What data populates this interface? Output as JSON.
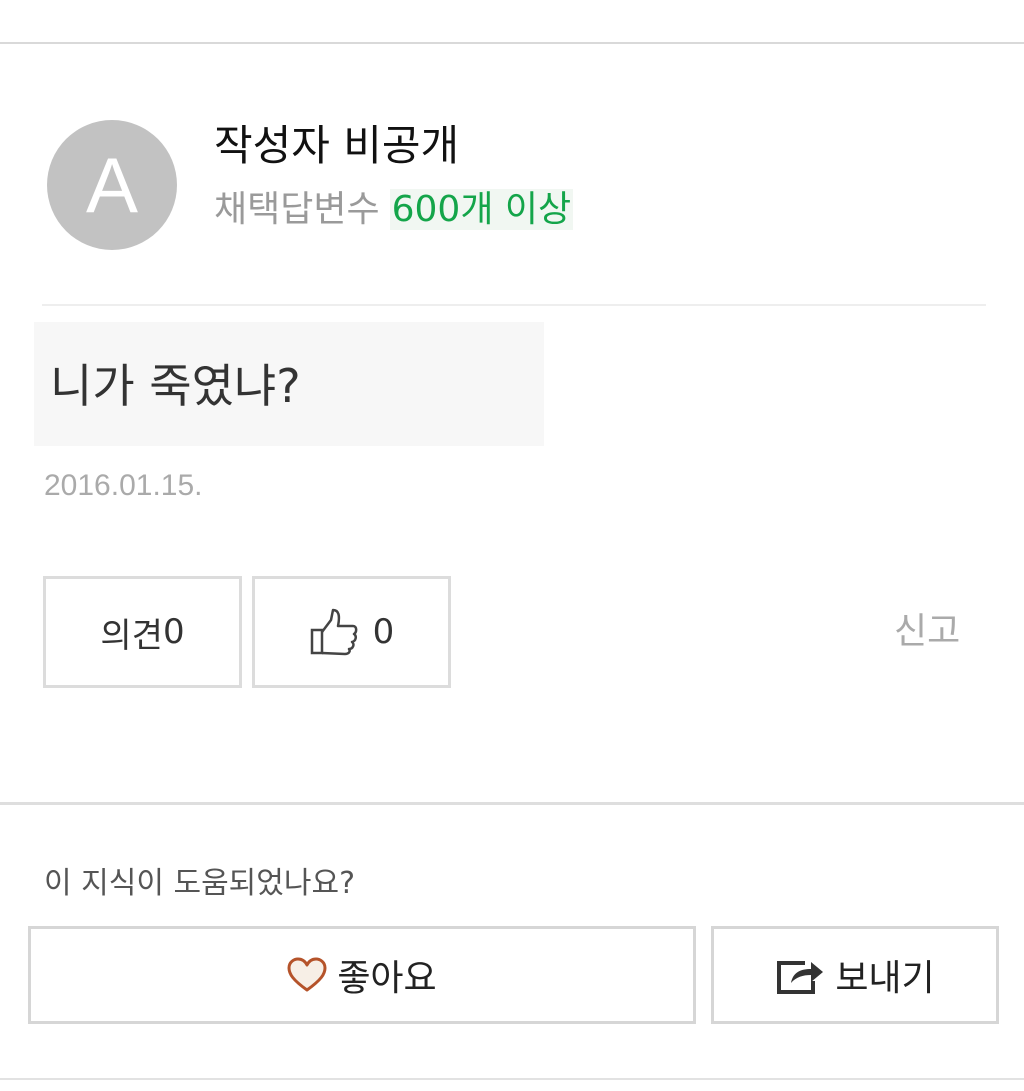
{
  "author": {
    "avatar_letter": "A",
    "name": "작성자 비공개",
    "meta_label": "채택답변수",
    "meta_count": "600개 이상",
    "count_color": "#14a54a"
  },
  "answer": {
    "text": "니가 죽였냐?",
    "date": "2016.01.15."
  },
  "actions": {
    "opinion_label": "의견",
    "opinion_count": "0",
    "like_icon": "thumbs-up-icon",
    "like_count": "0",
    "report_label": "신고"
  },
  "feedback": {
    "question": "이 지식이 도움되었나요?",
    "good_icon": "heart-icon",
    "good_label": "좋아요",
    "send_icon": "share-icon",
    "send_label": "보내기"
  }
}
